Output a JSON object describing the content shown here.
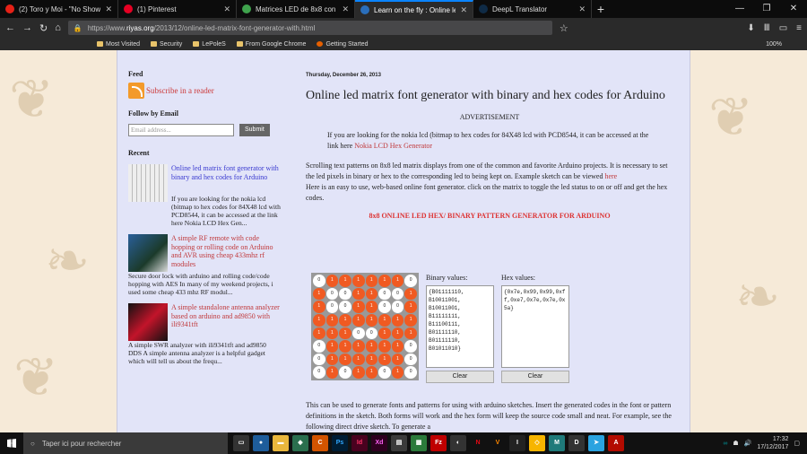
{
  "browser": {
    "tabs": [
      {
        "title": "(2) Toro y Moi - \"No Show\"",
        "color": "#e62117"
      },
      {
        "title": "(1) Pinterest",
        "color": "#e60023"
      },
      {
        "title": "Matrices LED de 8x8 con Ardu",
        "color": "#3fa34d"
      },
      {
        "title": "Learn on the fly : Online led m",
        "color": "#2a6ebb"
      },
      {
        "title": "DeepL Translator",
        "color": "#0f2b46"
      }
    ],
    "url_prefix": "https://www.",
    "url_domain": "riyas.org",
    "url_path": "/2013/12/online-led-matrix-font-generator-with.html",
    "bookmarks": [
      "Most Visited",
      "Security",
      "LePoleS",
      "From Google Chrome",
      "Getting Started"
    ],
    "zoom": "100%"
  },
  "sidebar": {
    "feed_heading": "Feed",
    "subscribe": "Subscribe in a reader",
    "follow_heading": "Follow by Email",
    "email_placeholder": "Email address...",
    "submit": "Submit",
    "recent_heading": "Recent",
    "recent": [
      {
        "title": "Online led matrix font generator with binary and hex codes for Arduino",
        "snippet": "If you are looking for the nokia lcd (bitmap to hex codes for 84X48 lcd with PCD8544, it can be accessed at the link here Nokia LCD Hex Gen..."
      },
      {
        "title": "A simple RF remote with code hopping or rolling code on Arduino and AVR using cheap 433mhz rf modules",
        "snippet": "Secure door lock with arduino and rolling code/code hopping with AES  In many of my weekend projects, i used some cheap 433 mhz RF modul..."
      },
      {
        "title": "A simple standalone antenna analyzer based on arduino and ad9850 with ili9341tft",
        "snippet": "A simple SWR analyzer with ili9341tft and ad9850 DDS A simple antenna analyzer is a helpful gadget which will tell us about the frequ..."
      }
    ]
  },
  "post": {
    "date": "Thursday, December 26, 2013",
    "title": "Online led matrix font generator with binary and hex codes for Arduino",
    "advertisement": "ADVERTISEMENT",
    "intro": "If you are looking for the nokia lcd (bitmap to hex codes for 84X48 lcd with PCD8544, it can be accessed at the link here",
    "intro_link": "Nokia LCD Hex Generator",
    "body1": "Scrolling text patterns on 8x8 led matrix displays from one of the common and favorite Arduino projects. It is necessary to set the led pixels in binary or hex to the corresponding led to being kept on. Example sketch can be viewed",
    "body1_link": "here",
    "body2": "Here is an easy to use, web-based online font generator. click on the matrix to toggle the led status to on or off and get the hex codes.",
    "generator_heading": "8x8 ONLINE LED HEX/ BINARY PATTERN GENERATOR FOR ARDUINO",
    "binary_label": "Binary values:",
    "hex_label": "Hex values:",
    "binary_values": "{B01111110,\nB10011001,\nB10011001,\nB11111111,\nB11100111,\nB01111110,\nB01111110,\nB01011010}",
    "hex_values": "{0x7e,0x99,0x99,0xff,0xe7,0x7e,0x7e,0x5a}",
    "clear": "Clear",
    "bottom": "This can be used to generate fonts and patterns for using with arduino sketches. Insert the generated codes in the font or pattern definitions in the sketch. Both forms will work and the hex form will keep the source code small and neat. For example, see the following direct drive sketch. To generate a"
  },
  "matrix": [
    "01111110",
    "10011001",
    "10011001",
    "11111111",
    "11100111",
    "01111110",
    "01111110",
    "01011010"
  ],
  "taskbar": {
    "search_placeholder": "Taper ici pour rechercher",
    "time": "17:32",
    "date": "17/12/2017"
  }
}
